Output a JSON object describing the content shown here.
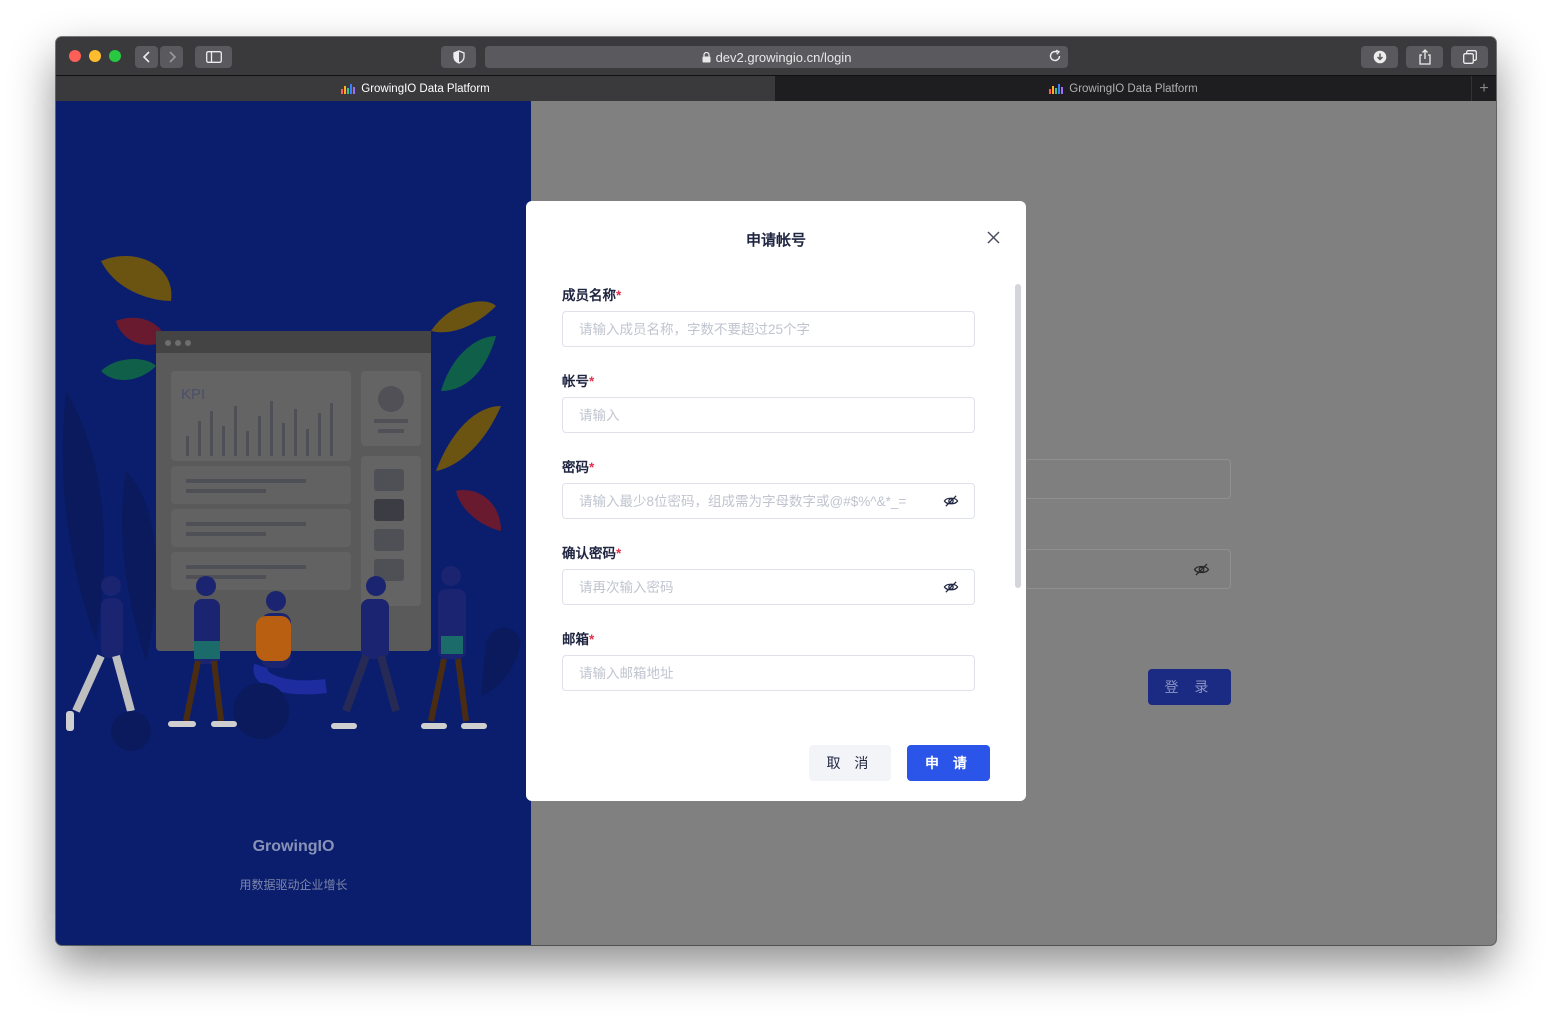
{
  "browser": {
    "url": "dev2.growingio.cn/login",
    "tabs": [
      {
        "title": "GrowingIO Data Platform",
        "active": true
      },
      {
        "title": "GrowingIO Data Platform",
        "active": false
      }
    ],
    "new_tab_label": "+"
  },
  "brand": {
    "name": "GrowingIO",
    "slogan": "用数据驱动企业增长",
    "illustration_label": "KPI",
    "panel_color": "#0b1e6e"
  },
  "background_form": {
    "login_label": "登 录"
  },
  "modal": {
    "title": "申请帐号",
    "fields": [
      {
        "label": "成员名称",
        "required": "*",
        "placeholder": "请输入成员名称，字数不要超过25个字",
        "value": ""
      },
      {
        "label": "帐号",
        "required": "*",
        "placeholder": "请输入",
        "value": ""
      },
      {
        "label": "密码",
        "required": "*",
        "placeholder": "请输入最少8位密码，组成需为字母数字或@#$%^&*_=",
        "value": "",
        "icon": "eye-hidden-icon"
      },
      {
        "label": "确认密码",
        "required": "*",
        "placeholder": "请再次输入密码",
        "value": "",
        "icon": "eye-hidden-icon"
      },
      {
        "label": "邮箱",
        "required": "*",
        "placeholder": "请输入邮箱地址",
        "value": ""
      }
    ],
    "cancel_label": "取 消",
    "submit_label": "申 请",
    "accent": "#2b55e8"
  }
}
